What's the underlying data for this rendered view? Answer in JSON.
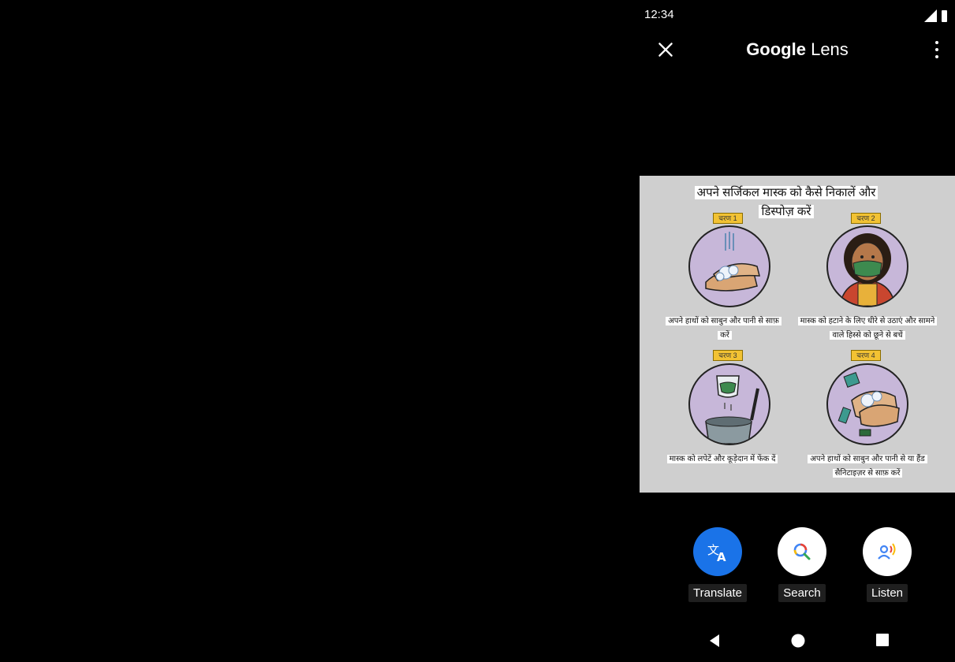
{
  "status": {
    "time": "12:34"
  },
  "appbar": {
    "title_brand": "Google",
    "title_rest": " Lens"
  },
  "poster": {
    "title": "अपने सर्जिकल मास्क को कैसे निकालें और डिस्पोज़ करें",
    "steps": [
      {
        "tag": "चरण 1",
        "caption": "अपने हाथों को साबुन और पानी से साफ़ करें"
      },
      {
        "tag": "चरण 2",
        "caption": "मास्क को हटाने के लिए धीरे से उठाएं और सामने वाले हिस्से को छूने से बचें"
      },
      {
        "tag": "चरण 3",
        "caption": "मास्क को लपेटें और कूड़ेदान में फेंक दें"
      },
      {
        "tag": "चरण 4",
        "caption": "अपने हाथों को साबुन और पानी से या हैंड सैनिटाइज़र से साफ़ करें"
      }
    ]
  },
  "actions": {
    "translate": {
      "label": "Translate",
      "icon": "translate-icon",
      "color": "#1a73e8"
    },
    "search": {
      "label": "Search",
      "icon": "search-icon",
      "color": "#ffffff"
    },
    "listen": {
      "label": "Listen",
      "icon": "listen-icon",
      "color": "#ffffff"
    }
  },
  "nav": {
    "back": "back-icon",
    "home": "home-icon",
    "recents": "recents-icon"
  }
}
